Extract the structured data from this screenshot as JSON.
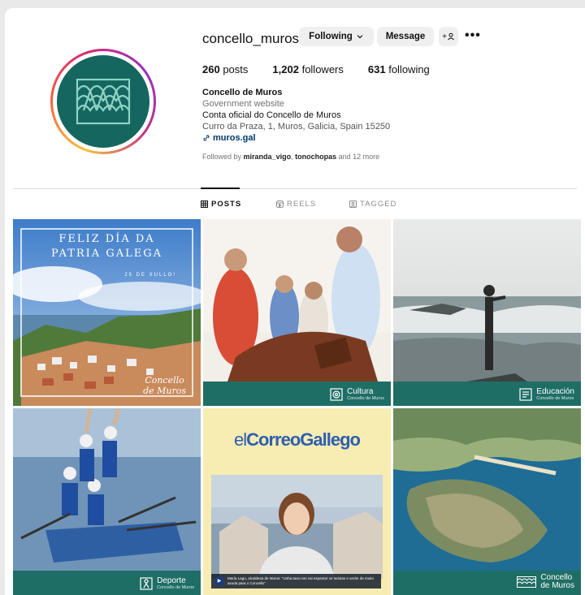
{
  "profile": {
    "username": "concello_muros",
    "following_label": "Following",
    "message_label": "Message",
    "suggest_label": "+",
    "more_label": "•••",
    "stats": {
      "posts_count": "260",
      "posts_label": "posts",
      "followers_count": "1,202",
      "followers_label": "followers",
      "following_count": "631",
      "following_label": "following"
    },
    "bio": {
      "name": "Concello de Muros",
      "category": "Government website",
      "description": "Conta oficial do Concello de Muros",
      "address": "Curro da Praza, 1, Muros, Galicia, Spain 15250",
      "link": "muros.gal"
    },
    "followed_by": {
      "prefix": "Followed by",
      "user1": "miranda_vigo",
      "separator": ",",
      "user2": "tonochopas",
      "suffix": "and 12 more"
    }
  },
  "tabs": [
    {
      "label": "POSTS",
      "icon": "grid-icon"
    },
    {
      "label": "REELS",
      "icon": "reels-icon"
    },
    {
      "label": "TAGGED",
      "icon": "tagged-icon"
    }
  ],
  "posts": [
    {
      "title_line1": "FELIZ DÍA DA",
      "title_line2": "PATRIA GALEGA",
      "date": "25 DE XULLO!",
      "logo_line1": "Concello",
      "logo_line2": "de Muros"
    },
    {
      "band_label": "Cultura",
      "band_sub": "Concello de Muros"
    },
    {
      "band_label": "Educación",
      "band_sub": "Concello de Muros"
    },
    {
      "band_label": "Deporte",
      "band_sub": "Concello de Muros"
    },
    {
      "brand_light": "el",
      "brand_bold": "CorreoGallego",
      "caption": "María Lago, alcaldesa de Muros: \"Unha taxa non vai espantar os turistas e serán de moito axuda para o Concello\""
    },
    {
      "band_label_line1": "Concello",
      "band_label_line2": "de Muros"
    }
  ],
  "colors": {
    "brand_teal": "#1f6e66",
    "link_blue": "#00376b"
  }
}
